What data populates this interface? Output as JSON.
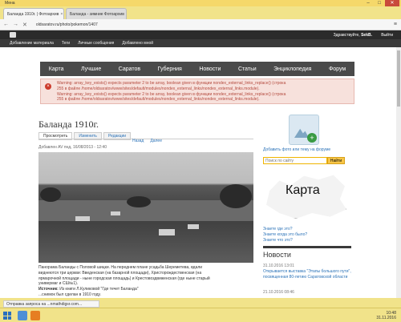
{
  "window": {
    "app_name": "Мена"
  },
  "tabs": [
    {
      "label": "Баланда 1910г. | Фотоархив",
      "active": true
    },
    {
      "label": "Баланда - зимние Фотоархив",
      "active": false
    }
  ],
  "addressbar": {
    "url": "oldsaratov.ru/photo/pokemon/1407"
  },
  "topbar": {
    "greeting": "Здравствуйте,",
    "user": "SekB.",
    "logout": "Выйти"
  },
  "adminbar": {
    "items": [
      "Добавление материала",
      "Теги",
      "Личные сообщения",
      "Добавлено мной"
    ]
  },
  "mainnav": {
    "items": [
      "Карта",
      "Лучшие",
      "Саратов",
      "Губерния",
      "Новости",
      "Статьи",
      "Энциклопедия",
      "Форум"
    ]
  },
  "warning": {
    "lines": [
      "Warning: array_key_exists() expects parameter 2 to be array, boolean given в функции nondex_external_links_replace() (строка",
      "255 в файле /home/oldsaratov/www/sites/default/modules/nondex_external_links/nondex_external_links.module).",
      "Warning: array_key_exists() expects parameter 2 to be array, boolean given в функции nondex_external_links_replace() (строка",
      "255 в файле /home/oldsaratov/www/sites/default/modules/nondex_external_links/nondex_external_links.module)."
    ]
  },
  "page": {
    "title": "Баланда 1910г.",
    "tabs": [
      "Просмотреть",
      "Изменить",
      "Редакции"
    ],
    "pager": {
      "prev": "Назад",
      "next": "Далее"
    },
    "meta": "Добавлен AV пнд, 16/08/2013 - 12:40",
    "caption": {
      "line1": "Панорама Баланды с Половой шицки. На переднем плане усадьба Шереметева, вдали",
      "line2": "виднеются три церкви: Введенская (на базарной площади), Христорождественская (на",
      "line3": "ярмарочной площади - ныне городская площадь) и Крестовоздвиженская (где ныне старый",
      "line4": "универмаг и СШ№1).",
      "source_label": "Источник:",
      "source_text": "Из книги Л.Куликовой \"Где течет Баланда\"",
      "line6": "...снимок был сделан в 1910 году."
    }
  },
  "sidebar": {
    "add_photo_link": "Добавить фото или тему на форуме",
    "search_placeholder": "Поиск по сайту",
    "search_button": "Найти",
    "map_label": "Карта",
    "quick_links": [
      "Знаете где это?",
      "Знаете когда это было?",
      "Знаете что это?"
    ],
    "news_heading": "Новости",
    "news": [
      {
        "date": "31.10.2016 13:01",
        "title": "Открывается выставка \"Этапы большого пути\", посвященная 80-летию Саратовской области"
      },
      {
        "date": "21.10.2016 08:46",
        "title": ""
      }
    ]
  },
  "status": {
    "text": "Отправка запроса на ...nmathdigsr.com..."
  },
  "clock": {
    "time": "10:48",
    "date": "31.11.2016"
  }
}
